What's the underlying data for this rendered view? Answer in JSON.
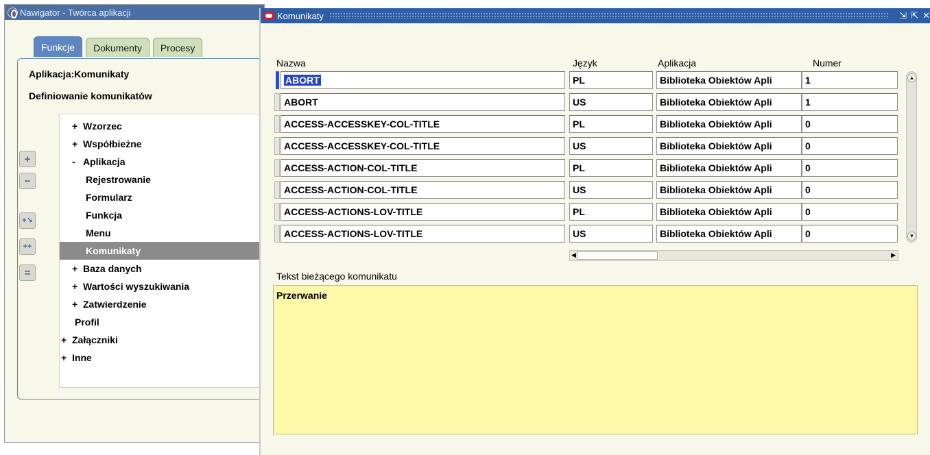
{
  "navigator": {
    "title": "Nawigator - Twórca aplikacji",
    "tabs": [
      "Funkcje",
      "Dokumenty",
      "Procesy"
    ],
    "application_label": "Aplikacja:Komunikaty",
    "section_label": "Definiowanie komunikatów",
    "tree": [
      {
        "prefix": "+",
        "label": "Wzorzec"
      },
      {
        "prefix": "+",
        "label": "Współbieżne"
      },
      {
        "prefix": "-",
        "label": "Aplikacja"
      },
      {
        "prefix": "",
        "label": "Rejestrowanie"
      },
      {
        "prefix": "",
        "label": "Formularz"
      },
      {
        "prefix": "",
        "label": "Funkcja"
      },
      {
        "prefix": "",
        "label": "Menu"
      },
      {
        "prefix": "",
        "label": "Komunikaty"
      },
      {
        "prefix": "+",
        "label": "Baza danych"
      },
      {
        "prefix": "+",
        "label": "Wartości wyszukiwania"
      },
      {
        "prefix": "+",
        "label": "Zatwierdzenie"
      },
      {
        "prefix": "",
        "label": "Profil"
      },
      {
        "prefix": "+",
        "label": "Załączniki"
      },
      {
        "prefix": "+",
        "label": "Inne"
      }
    ],
    "buttons": [
      "expand-one-icon",
      "collapse-one-icon",
      "expand-branch-icon",
      "expand-all-icon",
      "collapse-all-icon"
    ]
  },
  "messages": {
    "title": "Komunikaty",
    "columns": {
      "name": "Nazwa",
      "language": "Język",
      "application": "Aplikacja",
      "number": "Numer"
    },
    "rows": [
      {
        "name": "ABORT",
        "language": "PL",
        "application": "Biblioteka Obiektów Apli",
        "number": "1"
      },
      {
        "name": "ABORT",
        "language": "US",
        "application": "Biblioteka Obiektów Apli",
        "number": "1"
      },
      {
        "name": "ACCESS-ACCESSKEY-COL-TITLE",
        "language": "PL",
        "application": "Biblioteka Obiektów Apli",
        "number": "0"
      },
      {
        "name": "ACCESS-ACCESSKEY-COL-TITLE",
        "language": "US",
        "application": "Biblioteka Obiektów Apli",
        "number": "0"
      },
      {
        "name": "ACCESS-ACTION-COL-TITLE",
        "language": "PL",
        "application": "Biblioteka Obiektów Apli",
        "number": "0"
      },
      {
        "name": "ACCESS-ACTION-COL-TITLE",
        "language": "US",
        "application": "Biblioteka Obiektów Apli",
        "number": "0"
      },
      {
        "name": "ACCESS-ACTIONS-LOV-TITLE",
        "language": "PL",
        "application": "Biblioteka Obiektów Apli",
        "number": "0"
      },
      {
        "name": "ACCESS-ACTIONS-LOV-TITLE",
        "language": "US",
        "application": "Biblioteka Obiektów Apli",
        "number": "0"
      }
    ],
    "current_message_label": "Tekst bieżącego komunikatu",
    "current_message_text": "Przerwanie"
  },
  "colors": {
    "nav_titlebar": "#4a6fa5",
    "msg_titlebar": "#2d5da6",
    "selection": "#2744c5",
    "message_bg": "#fdf9a8"
  }
}
